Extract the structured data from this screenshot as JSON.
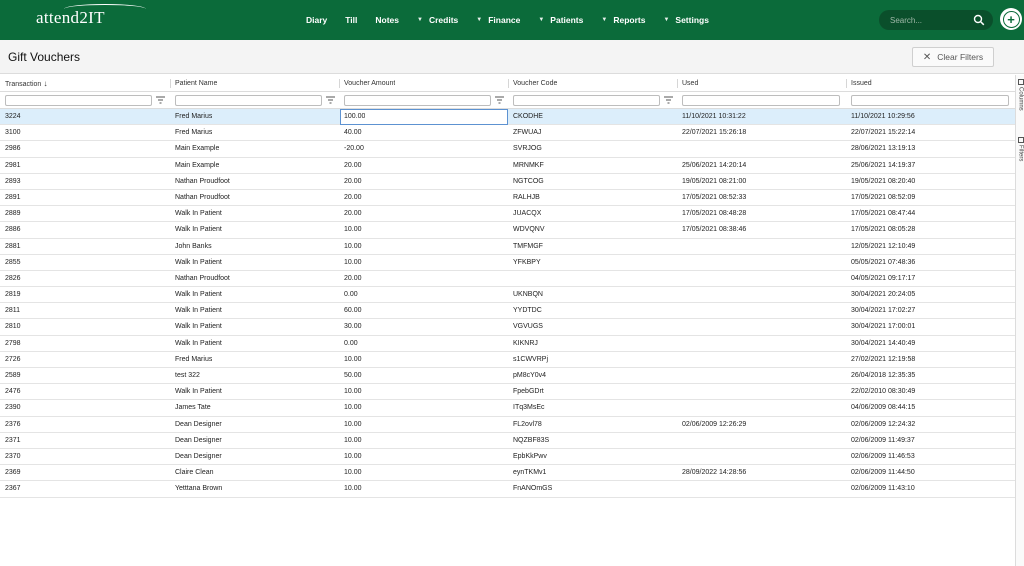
{
  "app": {
    "logo_text": "attend2IT"
  },
  "nav": {
    "items": [
      {
        "label": "Diary",
        "caret": false
      },
      {
        "label": "Till",
        "caret": false
      },
      {
        "label": "Notes",
        "caret": false
      },
      {
        "label": "Credits",
        "caret": true
      },
      {
        "label": "Finance",
        "caret": true
      },
      {
        "label": "Patients",
        "caret": true
      },
      {
        "label": "Reports",
        "caret": true
      },
      {
        "label": "Settings",
        "caret": true
      }
    ],
    "search_placeholder": "Search...",
    "search_icon": "search-icon",
    "add_icon": "plus-circle-icon"
  },
  "page": {
    "title": "Gift Vouchers",
    "clear_filters_label": "Clear Filters"
  },
  "table": {
    "columns": [
      "Transaction",
      "Patient Name",
      "Voucher Amount",
      "Voucher Code",
      "Used",
      "Issued"
    ],
    "sort_column": "Transaction",
    "sort_direction": "descending",
    "rows": [
      [
        "3224",
        "Fred Marius",
        "100.00",
        "CKODHE",
        "11/10/2021 10:31:22",
        "11/10/2021 10:29:56"
      ],
      [
        "3100",
        "Fred Marius",
        "40.00",
        "ZFWUAJ",
        "22/07/2021 15:26:18",
        "22/07/2021 15:22:14"
      ],
      [
        "2986",
        "Main Example",
        "-20.00",
        "SVRJOG",
        "",
        "28/06/2021 13:19:13"
      ],
      [
        "2981",
        "Main Example",
        "20.00",
        "MRNMKF",
        "25/06/2021 14:20:14",
        "25/06/2021 14:19:37"
      ],
      [
        "2893",
        "Nathan Proudfoot",
        "20.00",
        "NGTCOG",
        "19/05/2021 08:21:00",
        "19/05/2021 08:20:40"
      ],
      [
        "2891",
        "Nathan Proudfoot",
        "20.00",
        "RALHJB",
        "17/05/2021 08:52:33",
        "17/05/2021 08:52:09"
      ],
      [
        "2889",
        "Walk In Patient",
        "20.00",
        "JUACQX",
        "17/05/2021 08:48:28",
        "17/05/2021 08:47:44"
      ],
      [
        "2886",
        "Walk In Patient",
        "10.00",
        "WDVQNV",
        "17/05/2021 08:38:46",
        "17/05/2021 08:05:28"
      ],
      [
        "2881",
        "John Banks",
        "10.00",
        "TMFMGF",
        "",
        "12/05/2021 12:10:49"
      ],
      [
        "2855",
        "Walk In Patient",
        "10.00",
        "YFKBPY",
        "",
        "05/05/2021 07:48:36"
      ],
      [
        "2826",
        "Nathan Proudfoot",
        "20.00",
        "",
        "",
        "04/05/2021 09:17:17"
      ],
      [
        "2819",
        "Walk In Patient",
        "0.00",
        "UKNBQN",
        "",
        "30/04/2021 20:24:05"
      ],
      [
        "2811",
        "Walk In Patient",
        "60.00",
        "YYDTDC",
        "",
        "30/04/2021 17:02:27"
      ],
      [
        "2810",
        "Walk In Patient",
        "30.00",
        "VGVUGS",
        "",
        "30/04/2021 17:00:01"
      ],
      [
        "2798",
        "Walk In Patient",
        "0.00",
        "KIKNRJ",
        "",
        "30/04/2021 14:40:49"
      ],
      [
        "2726",
        "Fred Marius",
        "10.00",
        "s1CWVRPj",
        "",
        "27/02/2021 12:19:58"
      ],
      [
        "2589",
        "test 322",
        "50.00",
        "pM8cY0v4",
        "",
        "26/04/2018 12:35:35"
      ],
      [
        "2476",
        "Walk In Patient",
        "10.00",
        "FpebGDrt",
        "",
        "22/02/2010 08:30:49"
      ],
      [
        "2390",
        "James Tate",
        "10.00",
        "ITq3MsEc",
        "",
        "04/06/2009 08:44:15"
      ],
      [
        "2376",
        "Dean Designer",
        "10.00",
        "FL2ovl78",
        "02/06/2009 12:26:29",
        "02/06/2009 12:24:32"
      ],
      [
        "2371",
        "Dean Designer",
        "10.00",
        "NQZBF83S",
        "",
        "02/06/2009 11:49:37"
      ],
      [
        "2370",
        "Dean Designer",
        "10.00",
        "EpbKkPwv",
        "",
        "02/06/2009 11:46:53"
      ],
      [
        "2369",
        "Claire Clean",
        "10.00",
        "eynTKMv1",
        "28/09/2022 14:28:56",
        "02/06/2009 11:44:50"
      ],
      [
        "2367",
        "Yetttana Brown",
        "10.00",
        "FnANOmGS",
        "",
        "02/06/2009 11:43:10"
      ]
    ]
  },
  "side_panel": {
    "tabs": [
      "Columns",
      "Filters"
    ]
  },
  "colors": {
    "brand": "#0b6b3a",
    "selected_row": "#dceefb",
    "edit_border": "#5d92d1"
  }
}
